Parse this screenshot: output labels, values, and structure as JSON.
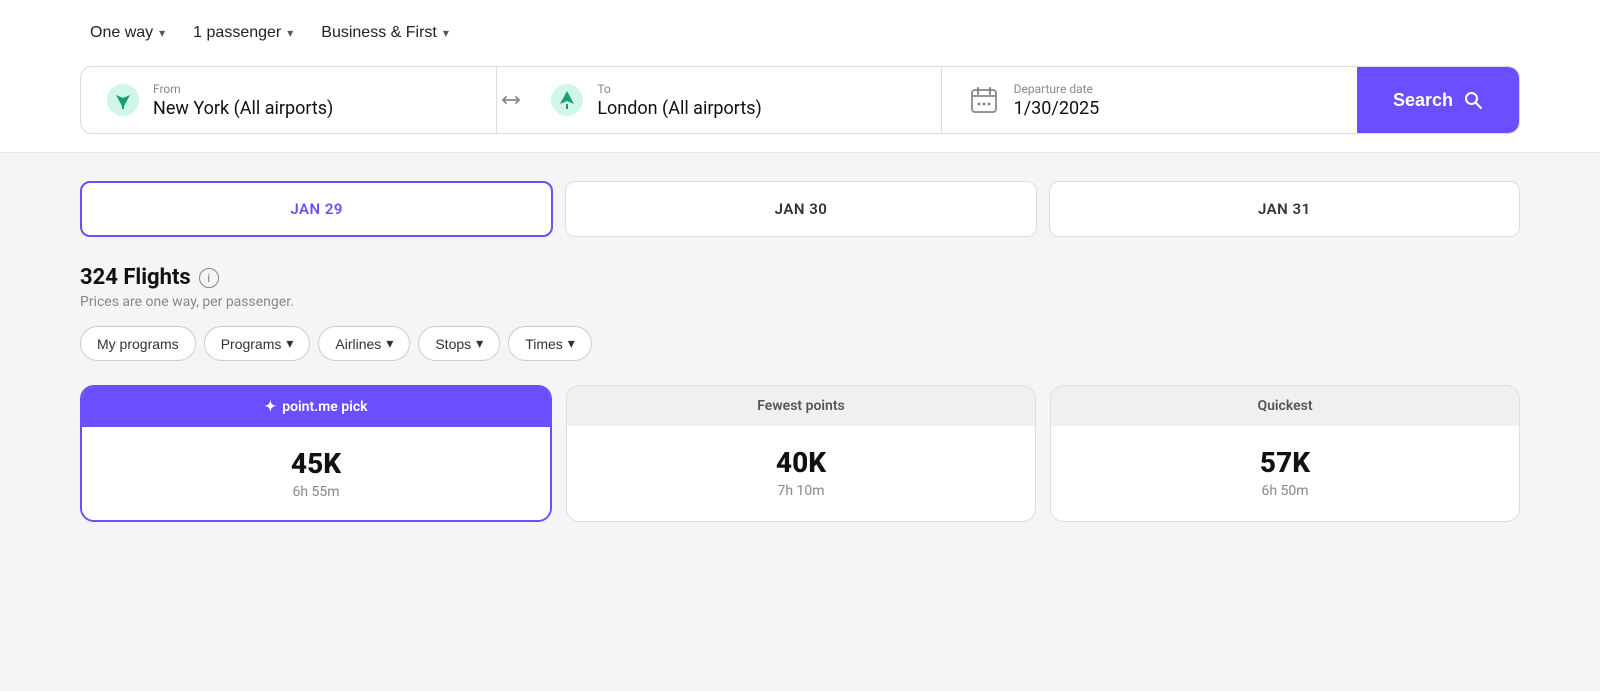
{
  "tripOptions": {
    "wayType": {
      "label": "One way",
      "chevron": "▾"
    },
    "passengers": {
      "label": "1 passenger",
      "chevron": "▾"
    },
    "cabinClass": {
      "label": "Business & First",
      "chevron": "▾"
    }
  },
  "searchBar": {
    "from": {
      "label": "From",
      "value": "New York (All airports)"
    },
    "to": {
      "label": "To",
      "value": "London (All airports)"
    },
    "departure": {
      "label": "Departure date",
      "value": "1/30/2025"
    },
    "searchButton": "Search"
  },
  "dateTabs": [
    {
      "label": "JAN 29",
      "active": true
    },
    {
      "label": "JAN 30",
      "active": false
    },
    {
      "label": "JAN 31",
      "active": false
    }
  ],
  "flightsInfo": {
    "count": "324 Flights",
    "subtitle": "Prices are one way, per passenger."
  },
  "filters": [
    {
      "label": "My programs",
      "hasChevron": false
    },
    {
      "label": "Programs",
      "hasChevron": true
    },
    {
      "label": "Airlines",
      "hasChevron": true
    },
    {
      "label": "Stops",
      "hasChevron": true
    },
    {
      "label": "Times",
      "hasChevron": true
    }
  ],
  "resultCards": [
    {
      "headerType": "featured",
      "headerIcon": "✦",
      "headerLabel": "point.me pick",
      "points": "45K",
      "duration": "6h 55m"
    },
    {
      "headerType": "plain",
      "headerLabel": "Fewest points",
      "points": "40K",
      "duration": "7h 10m"
    },
    {
      "headerType": "plain",
      "headerLabel": "Quickest",
      "points": "57K",
      "duration": "6h 50m"
    }
  ],
  "colors": {
    "accent": "#6B4EFF",
    "border": "#ddd",
    "text_primary": "#111",
    "text_secondary": "#888"
  }
}
